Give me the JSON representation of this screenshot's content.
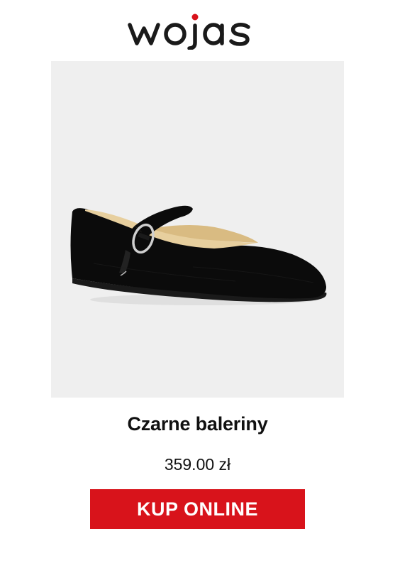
{
  "brand": {
    "logo_text": "wojas",
    "logo_dot_color": "#d8131b",
    "logo_color": "#1a1a1a"
  },
  "product": {
    "image_icon": "ballet-flat-shoe-image",
    "image_background": "#efefef",
    "name": "Czarne baleriny",
    "price": "359.00 zł"
  },
  "cta": {
    "label": "KUP ONLINE",
    "background": "#d8131b",
    "text_color": "#ffffff"
  }
}
